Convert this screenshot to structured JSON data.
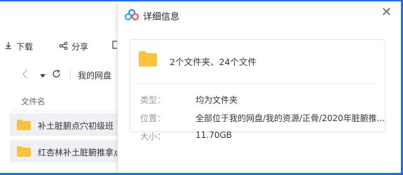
{
  "toolbar": {
    "download_label": "下载",
    "share_label": "分享"
  },
  "nav": {
    "path_label": "我的网盘"
  },
  "file_list": {
    "column_header": "文件名",
    "rows": [
      {
        "name": "补土脏腑点穴初级班"
      },
      {
        "name": "红杏林补土脏腑推拿点"
      }
    ]
  },
  "dialog": {
    "title": "详细信息",
    "close_glyph": "✕",
    "summary": "2个文件夹、24个文件",
    "type_label": "类型：",
    "type_value": "均为文件夹",
    "location_label": "位置：",
    "location_value": "全部位于我的网盘/我的资源/正骨/2020年脏腑推...",
    "size_label": "大小：",
    "size_value": "11.70GB"
  },
  "colors": {
    "accent": "#1e6fe6",
    "folder": "#f9c33c",
    "row_bg": "#eef0f4"
  },
  "icons": [
    "download-icon",
    "share-icon",
    "refresh-icon",
    "cloud-logo-icon",
    "folder-icon",
    "close-icon"
  ]
}
